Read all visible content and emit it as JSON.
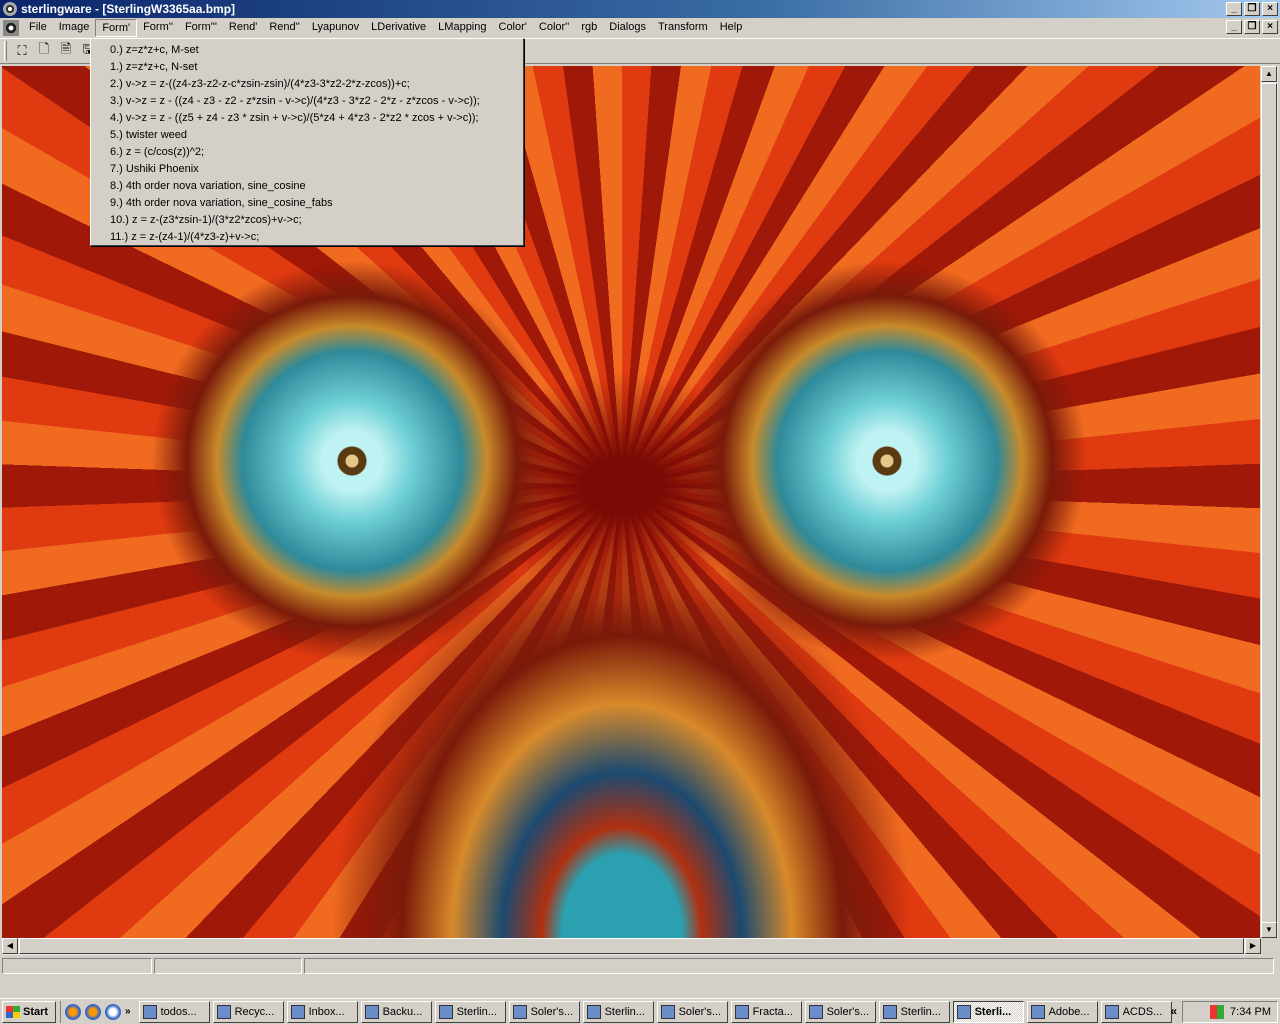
{
  "window": {
    "title": "sterlingware - [SterlingW3365aa.bmp]"
  },
  "menu": {
    "items": [
      "File",
      "Image",
      "Form'",
      "Form''",
      "Form'''",
      "Rend'",
      "Rend''",
      "Lyapunov",
      "LDerivative",
      "LMapping",
      "Color'",
      "Color''",
      "rgb",
      "Dialogs",
      "Transform",
      "Help"
    ],
    "active_index": 2
  },
  "dropdown": {
    "items": [
      "0.) z=z*z+c, M-set",
      "1.)  z=z*z+c, N-set",
      "2.) v->z = z-((z4-z3-z2-z-c*zsin-zsin)/(4*z3-3*z2-2*z-zcos))+c;",
      "3.) v->z = z - ((z4 - z3 - z2 - z*zsin - v->c)/(4*z3 - 3*z2 - 2*z -  z*zcos - v->c));",
      "4.) v->z = z - ((z5 + z4 - z3 * zsin + v->c)/(5*z4 + 4*z3 - 2*z2 * zcos + v->c));",
      "5.) twister weed",
      "6.) z = (c/cos(z))^2;",
      "7.) Ushiki Phoenix",
      "8.) 4th order nova variation, sine_cosine",
      "9.) 4th order nova variation, sine_cosine_fabs",
      "10.) z = z-(z3*zsin-1)/(3*z2*zcos)+v->c;",
      "11.) z = z-(z4-1)/(4*z3-z)+v->c;"
    ]
  },
  "taskbar": {
    "start_label": "Start",
    "tasks": [
      "todos...",
      "Recyc...",
      "Inbox...",
      "Backu...",
      "Sterlin...",
      "Soler's...",
      "Sterlin...",
      "Soler's...",
      "Fracta...",
      "Soler's...",
      "Sterlin...",
      "Sterli...",
      "Adobe...",
      "ACDS..."
    ],
    "active_index": 11,
    "clock": "7:34 PM",
    "chevron": "«"
  },
  "icons": {
    "toolbar": [
      "select-icon",
      "new-icon",
      "open-icon",
      "save-icon"
    ],
    "window_controls": [
      "minimize-icon",
      "restore-icon",
      "close-icon"
    ]
  }
}
